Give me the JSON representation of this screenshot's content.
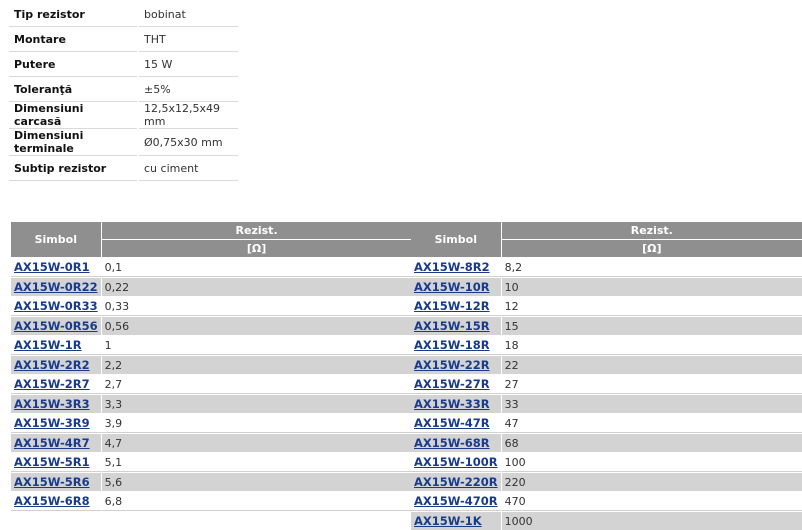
{
  "spec": [
    {
      "key": "Tip rezistor",
      "value": "bobinat"
    },
    {
      "key": "Montare",
      "value": "THT"
    },
    {
      "key": "Putere",
      "value": "15 W"
    },
    {
      "key": "Toleranţă",
      "value": "±5%"
    },
    {
      "key": "Dimensiuni carcasă",
      "value": "12,5x12,5x49 mm"
    },
    {
      "key": "Dimensiuni terminale",
      "value": "Ø0,75x30 mm"
    },
    {
      "key": "Subtip rezistor",
      "value": "cu ciment"
    }
  ],
  "headers": {
    "symbol": "Simbol",
    "resist": "Rezist.",
    "unit": "[Ω]"
  },
  "left_rows": [
    {
      "symbol": "AX15W-0R1",
      "value": "0,1"
    },
    {
      "symbol": "AX15W-0R22",
      "value": "0,22"
    },
    {
      "symbol": "AX15W-0R33",
      "value": "0,33"
    },
    {
      "symbol": "AX15W-0R56",
      "value": "0,56"
    },
    {
      "symbol": "AX15W-1R",
      "value": "1"
    },
    {
      "symbol": "AX15W-2R2",
      "value": "2,2"
    },
    {
      "symbol": "AX15W-2R7",
      "value": "2,7"
    },
    {
      "symbol": "AX15W-3R3",
      "value": "3,3"
    },
    {
      "symbol": "AX15W-3R9",
      "value": "3,9"
    },
    {
      "symbol": "AX15W-4R7",
      "value": "4,7"
    },
    {
      "symbol": "AX15W-5R1",
      "value": "5,1"
    },
    {
      "symbol": "AX15W-5R6",
      "value": "5,6"
    },
    {
      "symbol": "AX15W-6R8",
      "value": "6,8"
    }
  ],
  "right_rows": [
    {
      "symbol": "AX15W-8R2",
      "value": "8,2"
    },
    {
      "symbol": "AX15W-10R",
      "value": "10"
    },
    {
      "symbol": "AX15W-12R",
      "value": "12"
    },
    {
      "symbol": "AX15W-15R",
      "value": "15"
    },
    {
      "symbol": "AX15W-18R",
      "value": "18"
    },
    {
      "symbol": "AX15W-22R",
      "value": "22"
    },
    {
      "symbol": "AX15W-27R",
      "value": "27"
    },
    {
      "symbol": "AX15W-33R",
      "value": "33"
    },
    {
      "symbol": "AX15W-47R",
      "value": "47"
    },
    {
      "symbol": "AX15W-68R",
      "value": "68"
    },
    {
      "symbol": "AX15W-100R",
      "value": "100"
    },
    {
      "symbol": "AX15W-220R",
      "value": "220"
    },
    {
      "symbol": "AX15W-470R",
      "value": "470"
    },
    {
      "symbol": "AX15W-1K",
      "value": "1000"
    }
  ],
  "colors": {
    "header_bg": "#8f8f8f",
    "stripe_bg": "#d3d3d3",
    "link": "#1a3a8c"
  }
}
